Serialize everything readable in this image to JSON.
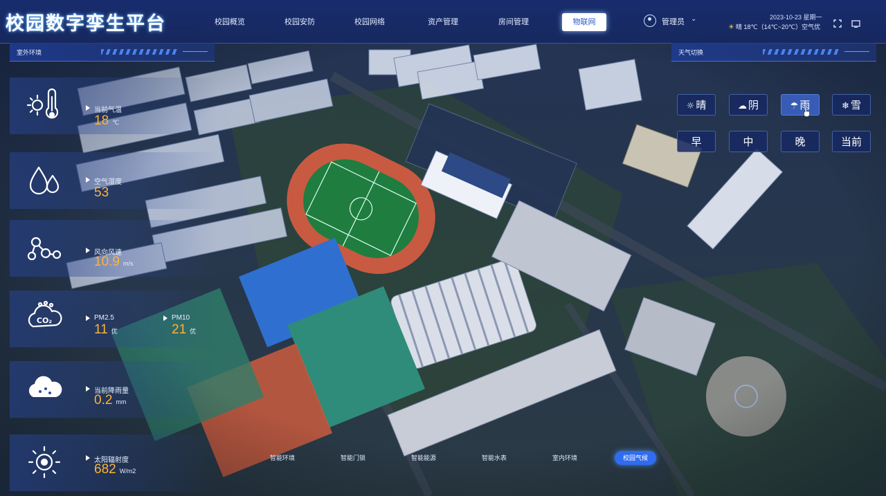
{
  "app": {
    "title": "校园数字孪生平台"
  },
  "nav": {
    "tabs": [
      {
        "label": "校园概览"
      },
      {
        "label": "校园安防"
      },
      {
        "label": "校园网络"
      },
      {
        "label": "资产管理"
      },
      {
        "label": "房间管理"
      },
      {
        "label": "物联网",
        "active": true
      }
    ]
  },
  "user": {
    "name": "管理员",
    "caret": "⌄"
  },
  "header": {
    "datetime": "2023-10-23 星期一",
    "weather": "晴 18℃（14℃~20℃）空气优",
    "sun_icon": "☀"
  },
  "left_panel": {
    "title": "室外环境"
  },
  "right_panel": {
    "title": "天气切换"
  },
  "metrics": [
    {
      "icon": "thermometer-sun-icon",
      "label": "当前气温",
      "value": "18",
      "unit": "℃"
    },
    {
      "icon": "humidity-drops-icon",
      "label": "空气湿度",
      "value": "53",
      "unit": ""
    },
    {
      "icon": "wind-nodes-icon",
      "label": "风向风速",
      "value": "10.9",
      "unit": "m/s"
    },
    {
      "icon": "co2-cloud-icon",
      "label_a": "PM2.5",
      "value_a": "11",
      "grade_a": "优",
      "label_b": "PM10",
      "value_b": "21",
      "grade_b": "优"
    },
    {
      "icon": "rain-cloud-icon",
      "label": "当前降雨量",
      "value": "0.2",
      "unit": "mm"
    },
    {
      "icon": "sun-radiation-icon",
      "label": "太阳辐射度",
      "value": "682",
      "unit": "W/m2"
    }
  ],
  "weather_buttons": {
    "sunny": {
      "icon": "☼",
      "label": "晴"
    },
    "cloudy": {
      "icon": "☁",
      "label": "阴"
    },
    "rain": {
      "icon": "☂",
      "label": "雨"
    },
    "snow": {
      "icon": "❄",
      "label": "雪"
    },
    "morning": {
      "label": "早"
    },
    "noon": {
      "label": "中"
    },
    "evening": {
      "label": "晚"
    },
    "current": {
      "label": "当前"
    }
  },
  "bottom_tabs": [
    {
      "label": "智能环境"
    },
    {
      "label": "智能门锁"
    },
    {
      "label": "智能能源"
    },
    {
      "label": "智能水表"
    },
    {
      "label": "室内环境"
    },
    {
      "label": "校园气候",
      "active": true
    }
  ],
  "colors": {
    "accent": "#2f6cf0",
    "value": "#ffb238",
    "panel": "#1c3586",
    "title_glow": "#5fb0ff"
  }
}
